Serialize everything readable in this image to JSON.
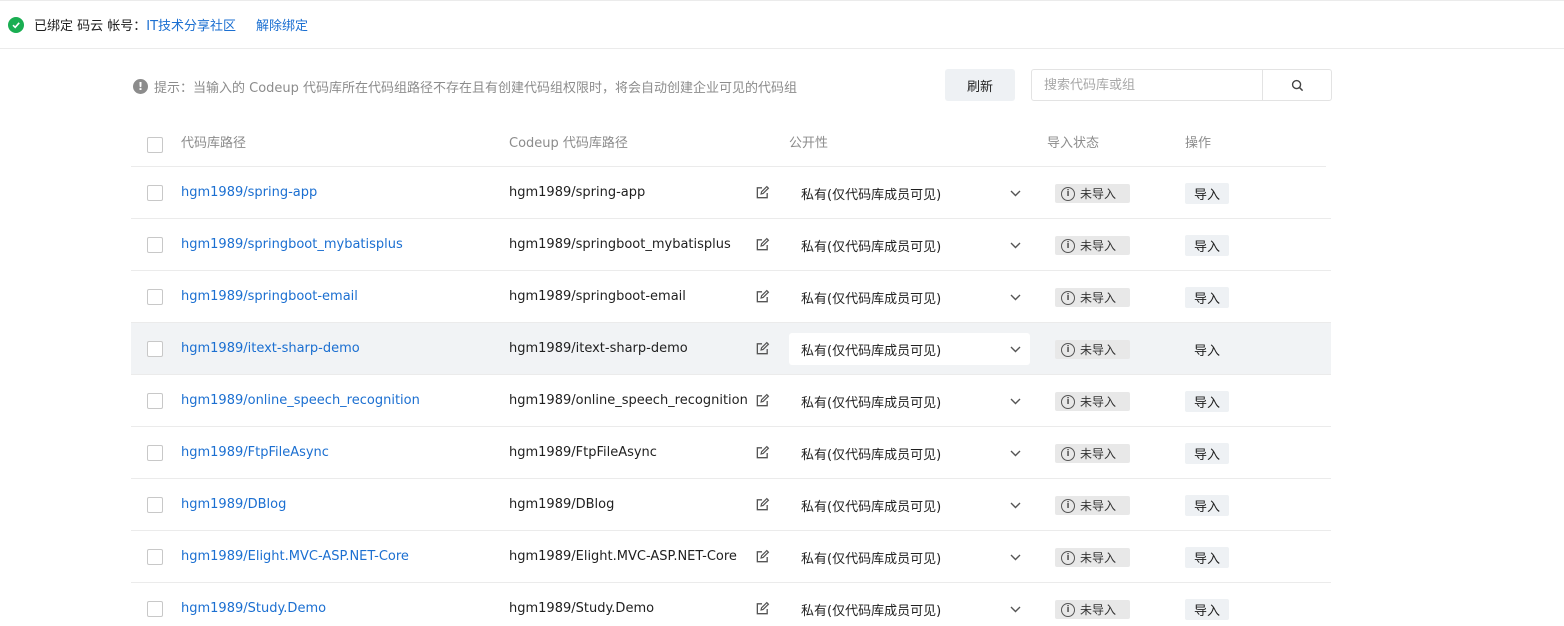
{
  "binding": {
    "status": "已绑定 码云 帐号：",
    "account": "IT技术分享社区",
    "unbind_label": "解除绑定"
  },
  "hint": "提示：当输入的 Codeup 代码库所在代码组路径不存在且有创建代码组权限时，将会自动创建企业可见的代码组",
  "toolbar": {
    "refresh_label": "刷新",
    "search_placeholder": "搜索代码库或组"
  },
  "table": {
    "columns": {
      "source": "代码库路径",
      "target": "Codeup 代码库路径",
      "visibility": "公开性",
      "status": "导入状态",
      "action": "操作"
    },
    "rows": [
      {
        "source": "hgm1989/spring-app",
        "target": "hgm1989/spring-app",
        "visibility": "私有(仅代码库成员可见)",
        "status": "未导入",
        "action": "导入"
      },
      {
        "source": "hgm1989/springboot_mybatisplus",
        "target": "hgm1989/springboot_mybatisplus",
        "visibility": "私有(仅代码库成员可见)",
        "status": "未导入",
        "action": "导入"
      },
      {
        "source": "hgm1989/springboot-email",
        "target": "hgm1989/springboot-email",
        "visibility": "私有(仅代码库成员可见)",
        "status": "未导入",
        "action": "导入"
      },
      {
        "source": "hgm1989/itext-sharp-demo",
        "target": "hgm1989/itext-sharp-demo",
        "visibility": "私有(仅代码库成员可见)",
        "status": "未导入",
        "action": "导入"
      },
      {
        "source": "hgm1989/online_speech_recognition",
        "target": "hgm1989/online_speech_recognition",
        "visibility": "私有(仅代码库成员可见)",
        "status": "未导入",
        "action": "导入"
      },
      {
        "source": "hgm1989/FtpFileAsync",
        "target": "hgm1989/FtpFileAsync",
        "visibility": "私有(仅代码库成员可见)",
        "status": "未导入",
        "action": "导入"
      },
      {
        "source": "hgm1989/DBlog",
        "target": "hgm1989/DBlog",
        "visibility": "私有(仅代码库成员可见)",
        "status": "未导入",
        "action": "导入"
      },
      {
        "source": "hgm1989/Elight.MVC-ASP.NET-Core",
        "target": "hgm1989/Elight.MVC-ASP.NET-Core",
        "visibility": "私有(仅代码库成员可见)",
        "status": "未导入",
        "action": "导入"
      },
      {
        "source": "hgm1989/Study.Demo",
        "target": "hgm1989/Study.Demo",
        "visibility": "私有(仅代码库成员可见)",
        "status": "未导入",
        "action": "导入"
      }
    ]
  },
  "colors": {
    "link": "#1b6fd1",
    "success": "#1aae52",
    "hover_row": "#f1f3f5"
  },
  "icons": [
    "check-circle-icon",
    "info-icon",
    "search-icon",
    "edit-icon",
    "chevron-down-icon"
  ]
}
